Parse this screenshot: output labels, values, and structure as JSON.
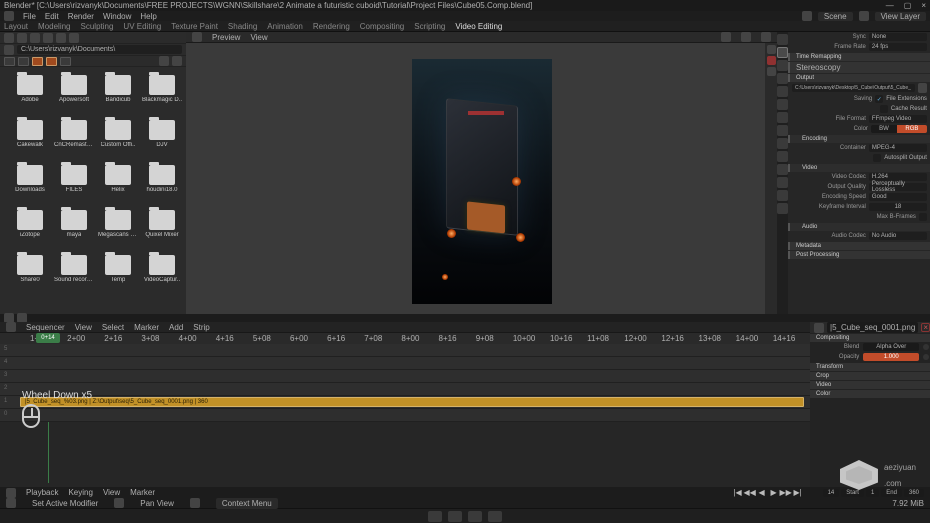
{
  "title": "Blender* [C:\\Users\\rizvanyk\\Documents\\FREE PROJECTS\\WGNN\\Skillshare\\2 Animate a futuristic cuboid\\Tutorial\\Project Files\\Cube05.Comp.blend]",
  "winCtrl": {
    "min": "—",
    "max": "▢",
    "close": "×"
  },
  "menu": [
    "File",
    "Edit",
    "Render",
    "Window",
    "Help"
  ],
  "sceneLabel": "Scene",
  "viewLayerLabel": "View Layer",
  "tabs": [
    "Layout",
    "Modeling",
    "Sculpting",
    "UV Editing",
    "Texture Paint",
    "Shading",
    "Animation",
    "Rendering",
    "Compositing",
    "Scripting",
    "Video Editing"
  ],
  "activeTab": 10,
  "files": {
    "path": "C:\\Users\\rizvanyk\\Documents\\",
    "folders": [
      "Adobe",
      "Apowersoft",
      "Bandicub",
      "Blackmagic D..",
      "Cakewalk",
      "CnCRemaster..",
      "Custom Offi..",
      "DJV",
      "Downloads",
      "FILES",
      "Helix",
      "houdini18.0",
      "iZotope",
      "maya",
      "Megascans Li..",
      "Quixel Mixer",
      "Share0",
      "Sound recordi..",
      "Temp",
      "VideoCaptur.."
    ]
  },
  "previewHdr": {
    "a": "Preview",
    "b": "View"
  },
  "output": {
    "frameRateLbl": "Frame Rate",
    "frameRateVal": "24 fps",
    "timeRemap": "Time Remapping",
    "stereo": "Stereoscopy",
    "out": "Output",
    "path": "C:\\Users\\rizvanyk\\Desktop\\5_Cube\\Output\\5_Cube_",
    "savingLbl": "Saving",
    "fileExt": "File Extensions",
    "cacheRes": "Cache Result",
    "fileFmtLbl": "File Format",
    "fileFmt": "FFmpeg Video",
    "colorLbl": "Color",
    "bw": "BW",
    "rgb": "RGB",
    "encoding": "Encoding",
    "containerLbl": "Container",
    "container": "MPEG-4",
    "autosplit": "Autosplit Output",
    "video": "Video",
    "codecLbl": "Video Codec",
    "codec": "H.264",
    "qualityLbl": "Output Quality",
    "quality": "Perceptually Lossless",
    "speedLbl": "Encoding Speed",
    "speed": "Good",
    "keyLbl": "Keyframe Interval",
    "key": "18",
    "maxBLbl": "Max B-Frames",
    "audio": "Audio",
    "acodecLbl": "Audio Codec",
    "acodec": "No Audio",
    "metadata": "Metadata",
    "postproc": "Post Processing"
  },
  "seq": {
    "hdr": [
      "Sequencer",
      "View",
      "Select",
      "Marker",
      "Add",
      "Strip"
    ],
    "playhead": "0+14",
    "ruler": [
      "1+08",
      "2+00",
      "2+16",
      "3+08",
      "4+00",
      "4+16",
      "5+08",
      "6+00",
      "6+16",
      "7+08",
      "8+00",
      "8+16",
      "9+08",
      "10+00",
      "10+16",
      "11+08",
      "12+00",
      "12+16",
      "13+08",
      "14+00",
      "14+16"
    ],
    "strip": "|5_Cube_seq_%03.png | Z:\\Output\\seq\\5_Cube_seq_0001.png | 360",
    "hint": "Wheel Down x5"
  },
  "stripPanel": {
    "name": "|5_Cube_seq_0001.png",
    "compositing": "Compositing",
    "blendLbl": "Blend",
    "blend": "Alpha Over",
    "opacityLbl": "Opacity",
    "opacity": "1.000",
    "panels": [
      "Transform",
      "Crop",
      "Video",
      "Color"
    ]
  },
  "transport": {
    "items": [
      "Playback",
      "Keying",
      "View",
      "Marker"
    ],
    "controls": [
      "|◀",
      "◀◀",
      "◀",
      "▶",
      "▶▶",
      "▶|"
    ],
    "cur": "14",
    "startLbl": "Start",
    "start": "1",
    "endLbl": "End",
    "end": "360"
  },
  "status": {
    "a": "Set Active Modifier",
    "b": "Pan View",
    "c": "Context Menu",
    "mem": "7.92 MiB"
  },
  "watermark": {
    "a": "aeziyuan",
    "b": ".com"
  }
}
